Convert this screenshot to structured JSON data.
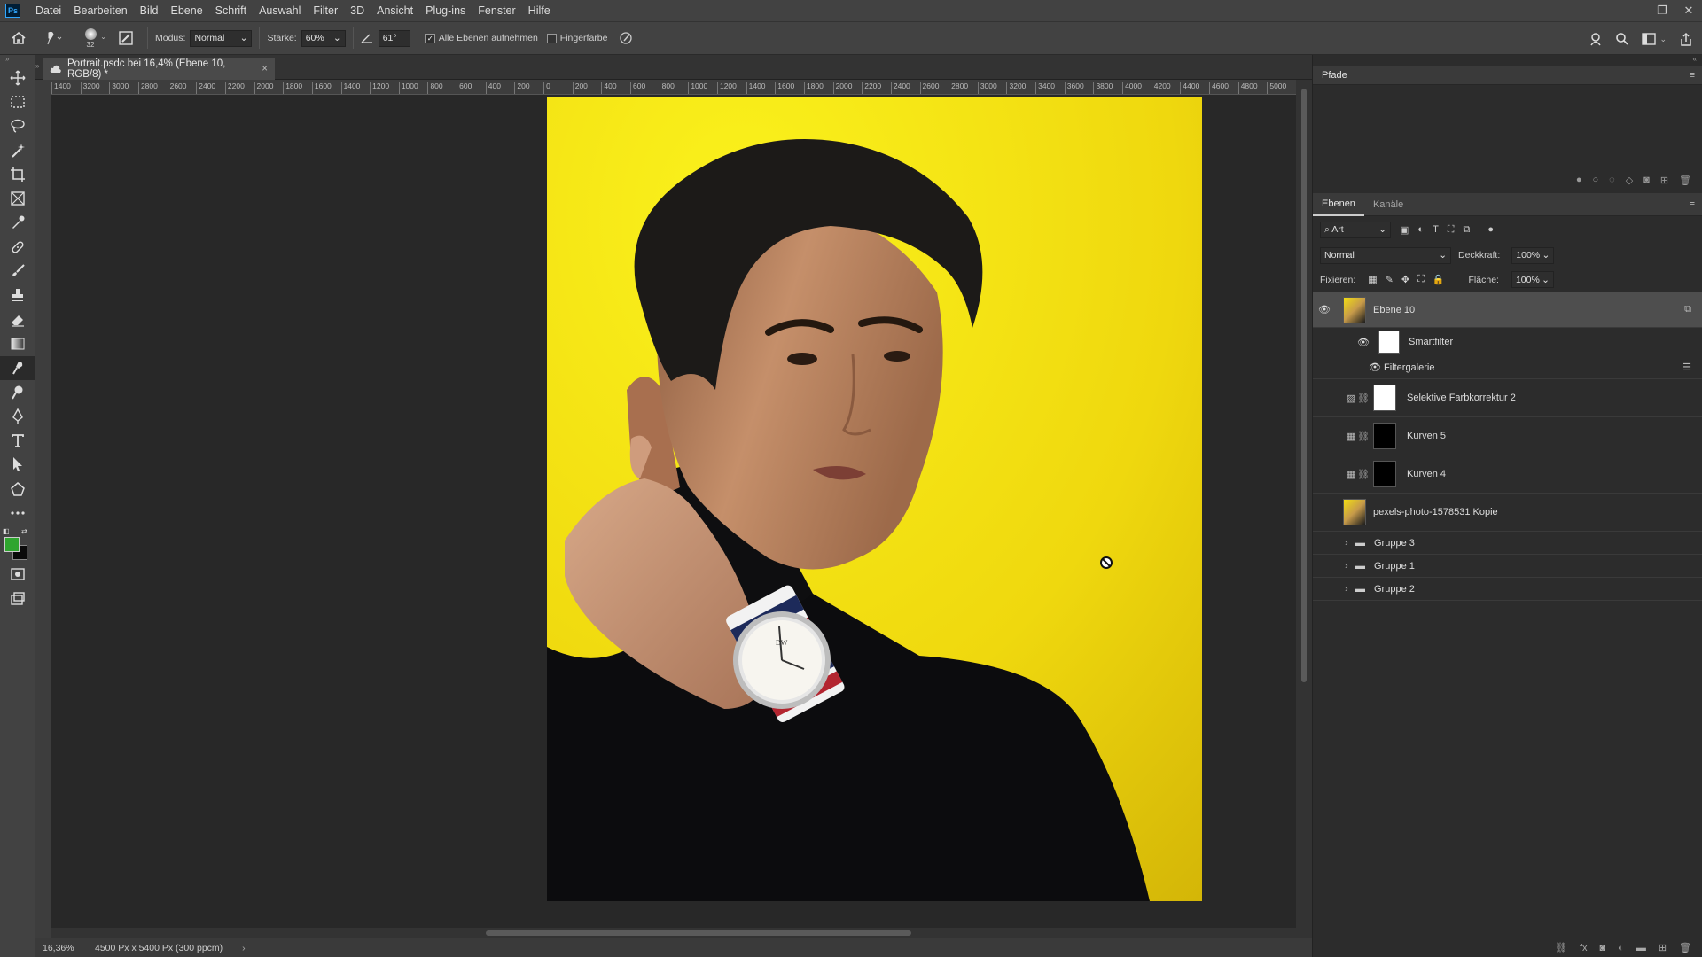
{
  "app": {
    "logo": "Ps"
  },
  "menu": [
    "Datei",
    "Bearbeiten",
    "Bild",
    "Ebene",
    "Schrift",
    "Auswahl",
    "Filter",
    "3D",
    "Ansicht",
    "Plug-ins",
    "Fenster",
    "Hilfe"
  ],
  "window_controls": {
    "minimize": "–",
    "restore": "❐",
    "close": "✕"
  },
  "options": {
    "brush_size": "32",
    "mode_label": "Modus:",
    "mode_value": "Normal",
    "strength_label": "Stärke:",
    "strength_value": "60%",
    "angle_value": "61°",
    "all_layers_label": "Alle Ebenen aufnehmen",
    "all_layers_checked": true,
    "finger_paint_label": "Fingerfarbe",
    "finger_paint_checked": false
  },
  "document": {
    "tab_title": "Portrait.psdc bei 16,4% (Ebene 10, RGB/8) *",
    "close": "×"
  },
  "ruler_h_labels": [
    "1400",
    "3200",
    "3000",
    "2800",
    "2600",
    "2400",
    "2200",
    "2000",
    "1800",
    "1600",
    "1400",
    "1200",
    "1000",
    "800",
    "600",
    "400",
    "200",
    "0",
    "200",
    "400",
    "600",
    "800",
    "1000",
    "1200",
    "1400",
    "1600",
    "1800",
    "2000",
    "2200",
    "2400",
    "2600",
    "2800",
    "3000",
    "3200",
    "3400",
    "3600",
    "3800",
    "4000",
    "4200",
    "4400",
    "4600",
    "4800",
    "5000"
  ],
  "status": {
    "zoom": "16,36%",
    "doc_size": "4500 Px x 5400 Px (300 ppcm)"
  },
  "paths_panel": {
    "title": "Pfade"
  },
  "layers_panel": {
    "tabs": [
      "Ebenen",
      "Kanäle"
    ],
    "filter_kind": "Art",
    "blend_mode": "Normal",
    "opacity_label": "Deckkraft:",
    "opacity_value": "100%",
    "lock_label": "Fixieren:",
    "fill_label": "Fläche:",
    "fill_value": "100%",
    "layers": [
      {
        "name": "Ebene 10",
        "visible": true,
        "selected": true,
        "kind": "smart"
      },
      {
        "name": "Smartfilter",
        "visible": true,
        "kind": "smartfilter"
      },
      {
        "name": "Filtergalerie",
        "visible": true,
        "kind": "filter"
      },
      {
        "name": "Selektive Farbkorrektur 2",
        "visible": false,
        "kind": "adjust-white"
      },
      {
        "name": "Kurven 5",
        "visible": false,
        "kind": "curves"
      },
      {
        "name": "Kurven 4",
        "visible": false,
        "kind": "curves"
      },
      {
        "name": "pexels-photo-1578531 Kopie",
        "visible": false,
        "kind": "image"
      },
      {
        "name": "Gruppe 3",
        "visible": false,
        "kind": "group"
      },
      {
        "name": "Gruppe 1",
        "visible": false,
        "kind": "group"
      },
      {
        "name": "Gruppe 2",
        "visible": false,
        "kind": "group"
      }
    ]
  },
  "colors": {
    "foreground": "#2fa52f",
    "background": "#0a0a0a",
    "photo_bg": "#f0e010"
  }
}
